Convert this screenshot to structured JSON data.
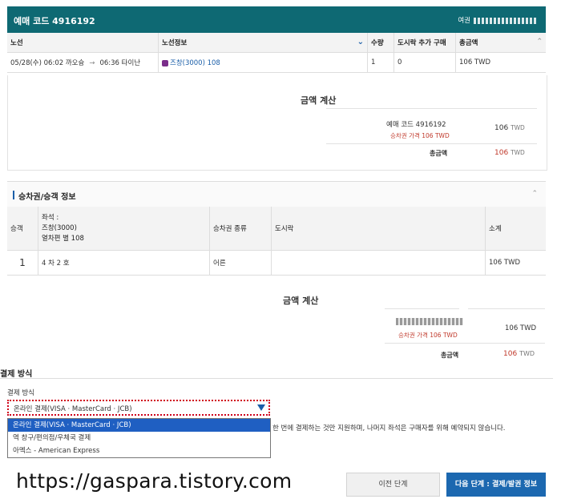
{
  "header": {
    "booking_code": "예매 코드  4916192",
    "right_label": "여권"
  },
  "route_table": {
    "headers": [
      "노선",
      "노선정보",
      "수량",
      "도시락 추가 구매",
      "총금액"
    ],
    "row": {
      "date_depart": "05/28(수) 06:02",
      "from": "까오슝",
      "arrive": "06:36",
      "to": "타이난",
      "train": "즈창(3000) 108",
      "qty": "1",
      "lunch": "0",
      "total": "106 TWD"
    }
  },
  "calc1": {
    "title": "금액 계산",
    "code": "예매 코드 4916192",
    "ticket_price": "승차권 가격 106 TWD",
    "amount": "106",
    "currency": "TWD",
    "total_label": "총금액",
    "total_amount": "106",
    "total_currency": "TWD"
  },
  "passenger_section": {
    "title": "승차권/승객 정보",
    "headers": {
      "passenger": "승객",
      "seat_l1": "좌석 :",
      "seat_l2": "즈창(3000)",
      "seat_l3": "열차편 별 108",
      "type": "승차권 종류",
      "lunch": "도시락",
      "subtotal": "소계"
    },
    "row": {
      "no": "1",
      "seat": "4 차 2 호",
      "type": "어른",
      "lunch": "",
      "subtotal": "106 TWD"
    }
  },
  "calc2": {
    "title": "금액 계산",
    "ticket_price": "승차권 가격 106 TWD",
    "amount": "106 TWD",
    "total_label": "총금액",
    "total_amount": "106",
    "total_currency": "TWD"
  },
  "payment": {
    "section_title": "결제 방식",
    "field_label": "결제 방식",
    "selected": "온라인 결제(VISA · MasterCard · JCB)",
    "options": [
      "온라인 결제(VISA · MasterCard · JCB)",
      "역 창구/편의점/우체국 결제",
      "아멕스 - American Express"
    ],
    "note": "한 번에 결제하는 것만 지원하며, 나머지 좌석은 구매자를 위해 예약되지 않습니다."
  },
  "watermark": "https://gaspara.tistory.com",
  "buttons": {
    "prev": "이전 단계",
    "next": "다음 단계 : 결제/발권 정보"
  },
  "colors": {
    "header_bg": "#0e6973",
    "accent": "#1a5ea8",
    "price_red": "#c0392b",
    "next_button": "#1c68b0"
  }
}
